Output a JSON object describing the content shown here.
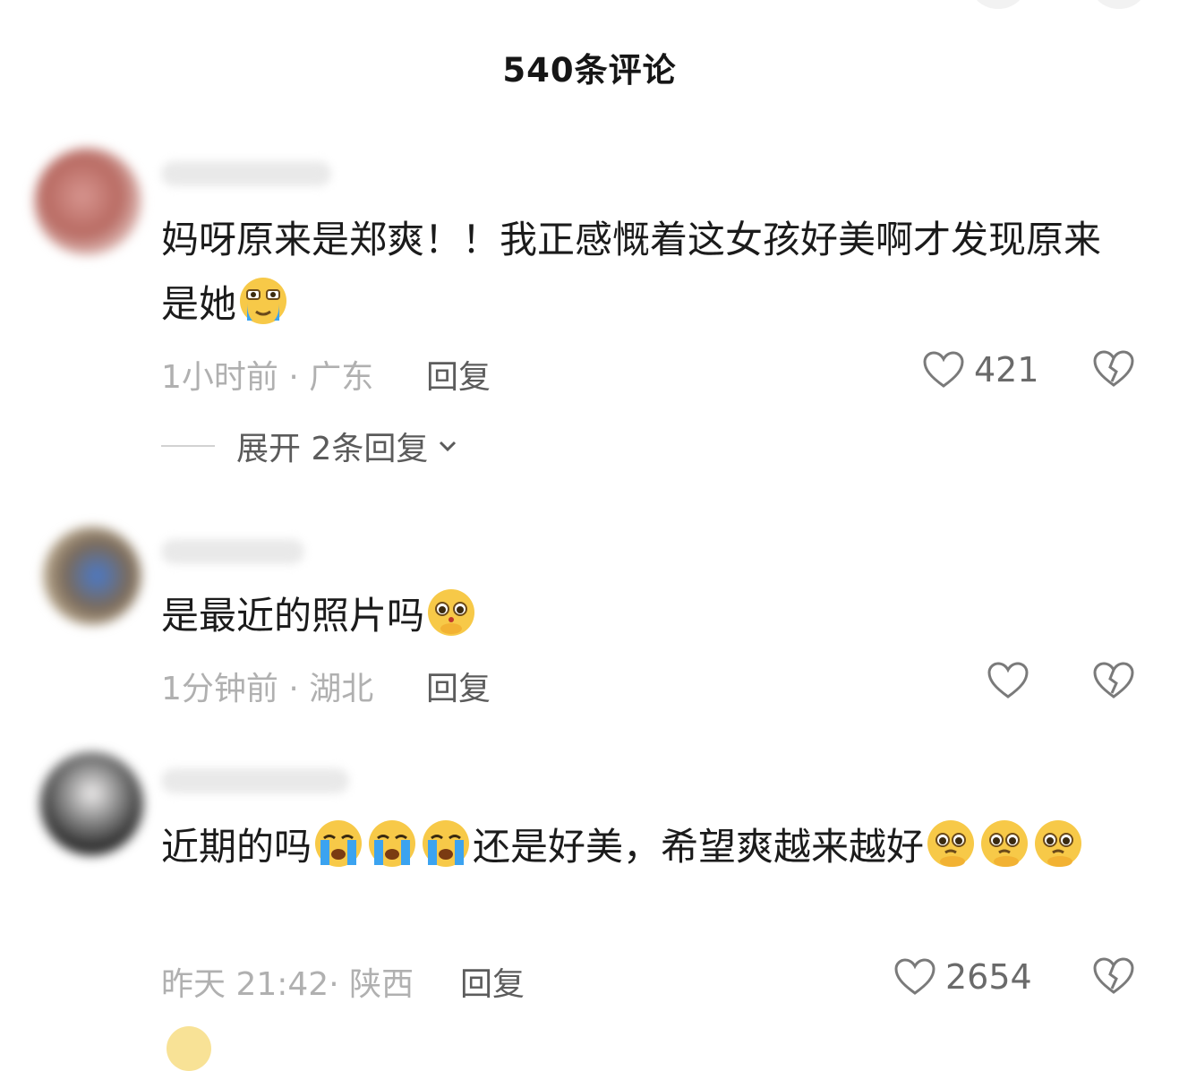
{
  "header": {
    "title": "540条评论"
  },
  "comments": [
    {
      "text_parts": [
        "妈呀原来是郑爽！！我正感慨着这女孩好美啊才发现原来是她"
      ],
      "emoji_after": [
        "crying-face-emoji"
      ],
      "time_location": "1小时前 · 广东",
      "reply_label": "回复",
      "like_count": "421",
      "expand": "展开 2条回复"
    },
    {
      "text_parts": [
        "是最近的照片吗"
      ],
      "emoji_after": [
        "shy-face-emoji"
      ],
      "time_location": "1分钟前 · 湖北",
      "reply_label": "回复",
      "like_count": ""
    },
    {
      "text_parts": [
        "近期的吗",
        "还是好美，希望爽越来越好"
      ],
      "emoji_mid": [
        "loudly-crying-emoji",
        "loudly-crying-emoji",
        "loudly-crying-emoji"
      ],
      "emoji_after": [
        "pleading-face-emoji",
        "pleading-face-emoji",
        "pleading-face-emoji"
      ],
      "time_location": "昨天 21:42· 陕西",
      "reply_label": "回复",
      "like_count": "2654"
    }
  ],
  "colors": {
    "accent": "#1b1b1b",
    "muted": "#b0b0b0",
    "emoji": "#f7c948",
    "tear": "#3ba3f0"
  }
}
